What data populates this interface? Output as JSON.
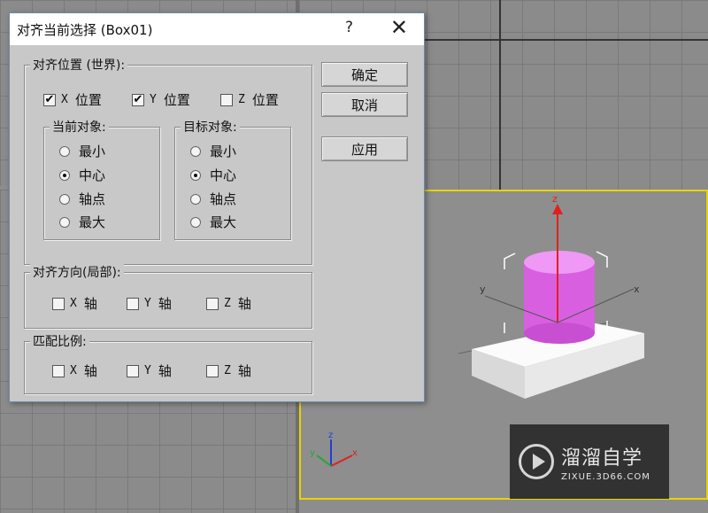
{
  "dialog": {
    "title": "对齐当前选择 (Box01)",
    "help": "?",
    "close": "✕",
    "align_position": {
      "legend": "对齐位置 (世界):",
      "x": {
        "axis": "X",
        "label": "位置",
        "checked": "✔"
      },
      "y": {
        "axis": "Y",
        "label": "位置",
        "checked": "✔"
      },
      "z": {
        "axis": "Z",
        "label": "位置",
        "checked": ""
      }
    },
    "current_object": {
      "legend": "当前对象:",
      "options": [
        "最小",
        "中心",
        "轴点",
        "最大"
      ],
      "selected": "中心"
    },
    "target_object": {
      "legend": "目标对象:",
      "options": [
        "最小",
        "中心",
        "轴点",
        "最大"
      ],
      "selected": "中心"
    },
    "align_orientation": {
      "legend": "对齐方向(局部):",
      "x": {
        "axis": "X",
        "label": "轴"
      },
      "y": {
        "axis": "Y",
        "label": "轴"
      },
      "z": {
        "axis": "Z",
        "label": "轴"
      }
    },
    "match_scale": {
      "legend": "匹配比例:",
      "x": {
        "axis": "X",
        "label": "轴"
      },
      "y": {
        "axis": "Y",
        "label": "轴"
      },
      "z": {
        "axis": "Z",
        "label": "轴"
      }
    },
    "buttons": {
      "ok": "确定",
      "cancel": "取消",
      "apply": "应用"
    }
  },
  "viewport": {
    "gizmo_labels": {
      "x": "x",
      "y": "y",
      "z": "z"
    },
    "axis_tripod": {
      "x": "x",
      "y": "y",
      "z": "z"
    },
    "colors": {
      "active_border": "#e6d400",
      "cylinder": "#e070e8",
      "box": "#f2f2f2",
      "gizmo_z": "#e02020"
    }
  },
  "watermark": {
    "main": "溜溜自学",
    "sub": "ZIXUE.3D66.COM"
  }
}
